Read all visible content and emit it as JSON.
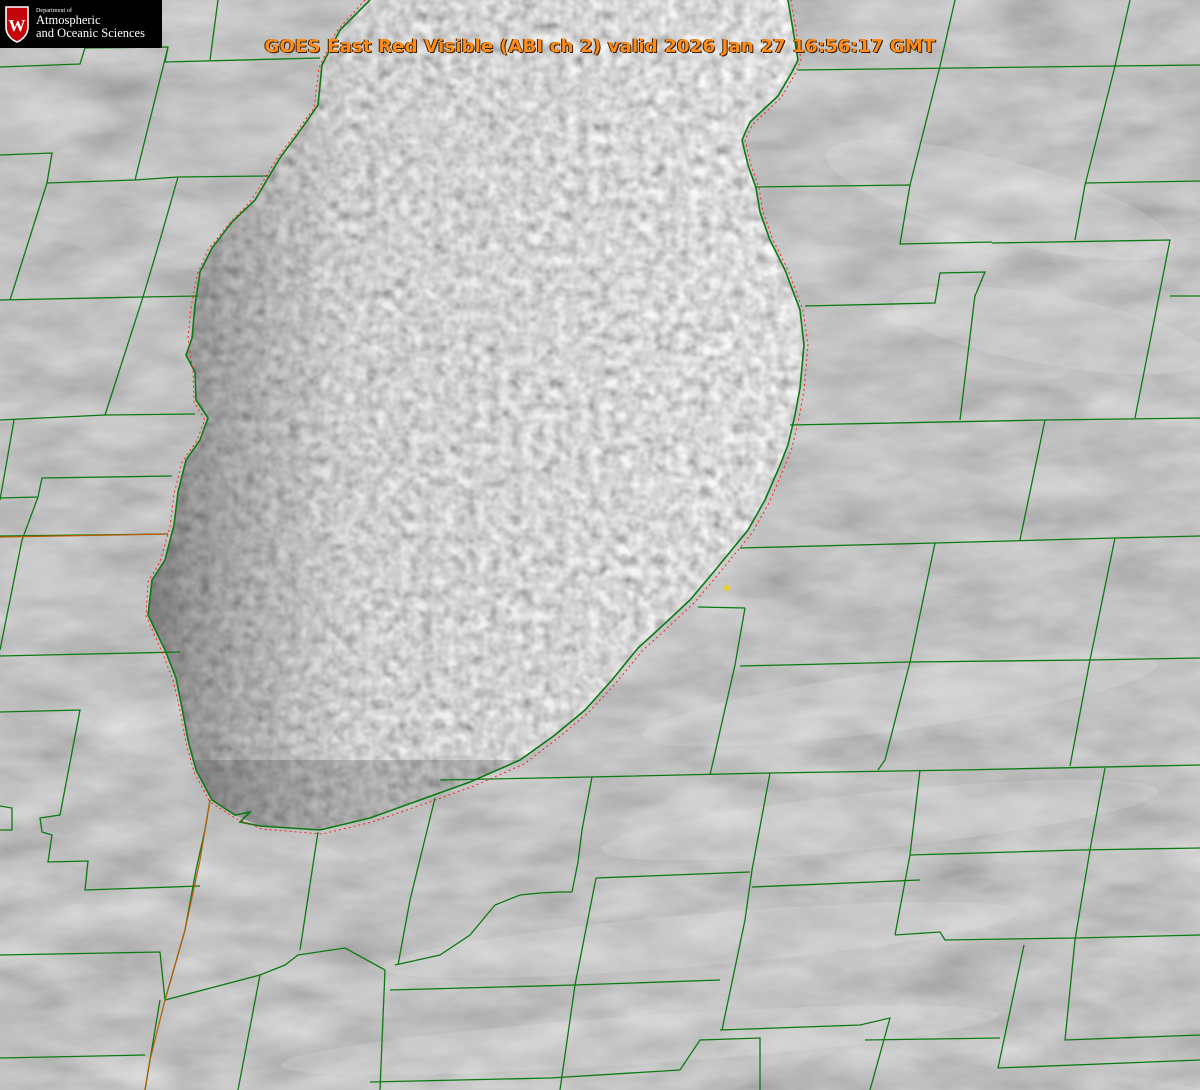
{
  "title": "GOES East Red Visible (ABI ch 2) valid 2026 Jan 27 16:56:17 GMT",
  "logo": {
    "department": "Department of",
    "line1": "Atmospheric",
    "line2": "and Oceanic Sciences",
    "icon": "university-shield-w-icon",
    "letter": "W"
  },
  "colors": {
    "county_lines": "#0c7a12",
    "state_border": "#b85a00",
    "lake_outline_dotted": "#ff2020",
    "title_text": "#ff8c1a",
    "station_marker": "#e8d31c",
    "shield": "#c5050c"
  }
}
